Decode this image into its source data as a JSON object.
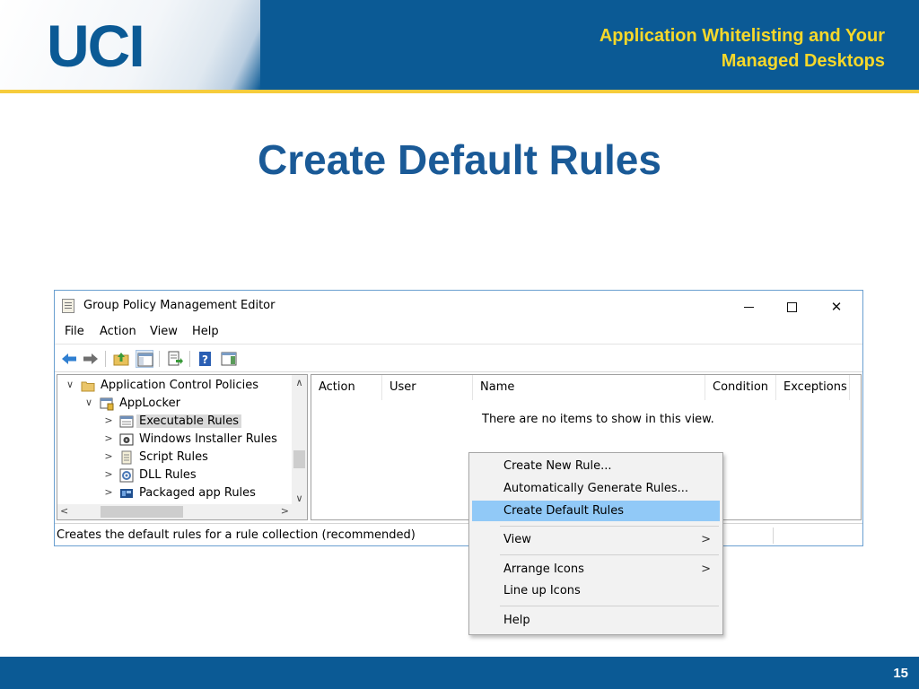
{
  "slide": {
    "logo": "UCI",
    "header_title_line1": "Application Whitelisting and Your",
    "header_title_line2": "Managed Desktops",
    "title": "Create Default Rules",
    "page_number": "15",
    "colors": {
      "brand_blue": "#0b5a95",
      "gold": "#f6cc3c",
      "title_blue": "#1a5a97"
    }
  },
  "window": {
    "title": "Group Policy Management Editor",
    "controls": {
      "minimize": "minimize-icon",
      "maximize": "maximize-icon",
      "close": "close-icon"
    },
    "close_glyph": "✕",
    "menu": [
      "File",
      "Action",
      "View",
      "Help"
    ],
    "toolbar_icons": [
      "back-arrow-icon",
      "forward-arrow-icon",
      "up-folder-icon",
      "show-hide-tree-icon",
      "export-list-icon",
      "help-icon",
      "action-pane-icon"
    ],
    "tree": [
      {
        "label": "Application Control Policies",
        "arrow": "∨",
        "icon": "folder-icon"
      },
      {
        "label": "AppLocker",
        "arrow": "∨",
        "icon": "applocker-icon"
      },
      {
        "label": "Executable Rules",
        "arrow": ">",
        "icon": "rules-icon",
        "selected": true
      },
      {
        "label": "Windows Installer Rules",
        "arrow": ">",
        "icon": "installer-icon"
      },
      {
        "label": "Script Rules",
        "arrow": ">",
        "icon": "script-icon"
      },
      {
        "label": "DLL Rules",
        "arrow": ">",
        "icon": "dll-icon"
      },
      {
        "label": "Packaged app Rules",
        "arrow": ">",
        "icon": "packaged-app-icon"
      }
    ],
    "scroll_glyphs": {
      "up": "∧",
      "down": "∨",
      "left": "<",
      "right": ">"
    },
    "columns": [
      "Action",
      "User",
      "Name",
      "Condition",
      "Exceptions"
    ],
    "empty_message": "There are no items to show in this view.",
    "status": "Creates the default rules for a rule collection (recommended)"
  },
  "context_menu": {
    "items": [
      {
        "label": "Create New Rule..."
      },
      {
        "label": "Automatically Generate Rules..."
      },
      {
        "label": "Create Default Rules",
        "highlighted": true
      },
      {
        "label": "View",
        "submenu": ">"
      },
      {
        "label": "Arrange Icons",
        "submenu": ">"
      },
      {
        "label": "Line up Icons"
      },
      {
        "label": "Help"
      }
    ]
  }
}
